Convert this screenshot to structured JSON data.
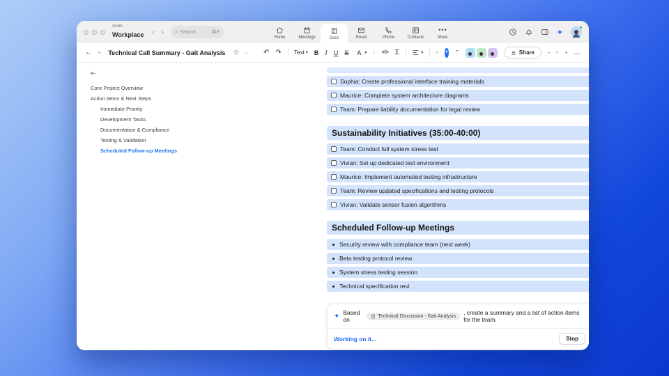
{
  "topbar": {
    "logo_top": "zoom",
    "logo_bottom": "Workplace",
    "search": {
      "placeholder": "Search",
      "shortcut": "⌘F"
    },
    "nav": [
      {
        "label": "Home"
      },
      {
        "label": "Meetings"
      },
      {
        "label": "Docs"
      },
      {
        "label": "Email"
      },
      {
        "label": "Phone"
      },
      {
        "label": "Contacts"
      },
      {
        "label": "More"
      }
    ]
  },
  "doc_toolbar": {
    "title": "Technical Call Summary - Gait Analysis",
    "text_style_label": "Text",
    "color_label": "A",
    "bold_label": "B",
    "italic_label": "I",
    "underline_label": "U",
    "strike_label": "S",
    "sigma_label": "Σ",
    "code_label": "</>",
    "share_label": "Share"
  },
  "sidebar": {
    "items": [
      {
        "label": "Core Project Overview"
      },
      {
        "label": "Action Items & Next Steps"
      },
      {
        "label": "Immediate Priority"
      },
      {
        "label": "Development Tasks"
      },
      {
        "label": "Documentation & Compliance"
      },
      {
        "label": "Testing & Validation"
      },
      {
        "label": "Scheduled Follow-up Meetings"
      }
    ]
  },
  "document": {
    "blocks": [
      {
        "type": "todo",
        "text": "Sophia: Create professional interface training materials"
      },
      {
        "type": "todo",
        "text": "Maurice: Complete system architecture diagrams"
      },
      {
        "type": "todo",
        "text": "Team: Prepare liability documentation for legal review"
      },
      {
        "type": "heading",
        "text": "Sustainability Initiatives (35:00-40:00)"
      },
      {
        "type": "todo",
        "text": "Team: Conduct full system stress test"
      },
      {
        "type": "todo",
        "text": "Vivian: Set up dedicated test environment"
      },
      {
        "type": "todo",
        "text": "Maurice: Implement automated testing infrastructure"
      },
      {
        "type": "todo",
        "text": "Team: Review updated specifications and testing protocols"
      },
      {
        "type": "todo",
        "text": "Vivian: Validate sensor fusion algorithms"
      },
      {
        "type": "heading",
        "text": "Scheduled Follow-up Meetings"
      },
      {
        "type": "bullet",
        "text": "Security review with compliance team (next week)"
      },
      {
        "type": "bullet",
        "text": "Beta testing protocol review"
      },
      {
        "type": "bullet",
        "text": "System stress testing session"
      },
      {
        "type": "bullet",
        "text": "Technical specification revi"
      }
    ]
  },
  "ai_panel": {
    "prefix": "Based on",
    "chip_label": "Technical Discussion - Gait Analysis",
    "suffix": ", create a summary and a list of action items for the team.",
    "status": "Working on it...",
    "stop_label": "Stop"
  },
  "colors": {
    "highlight": "#d3e3fb",
    "accent": "#1f6cf5"
  }
}
